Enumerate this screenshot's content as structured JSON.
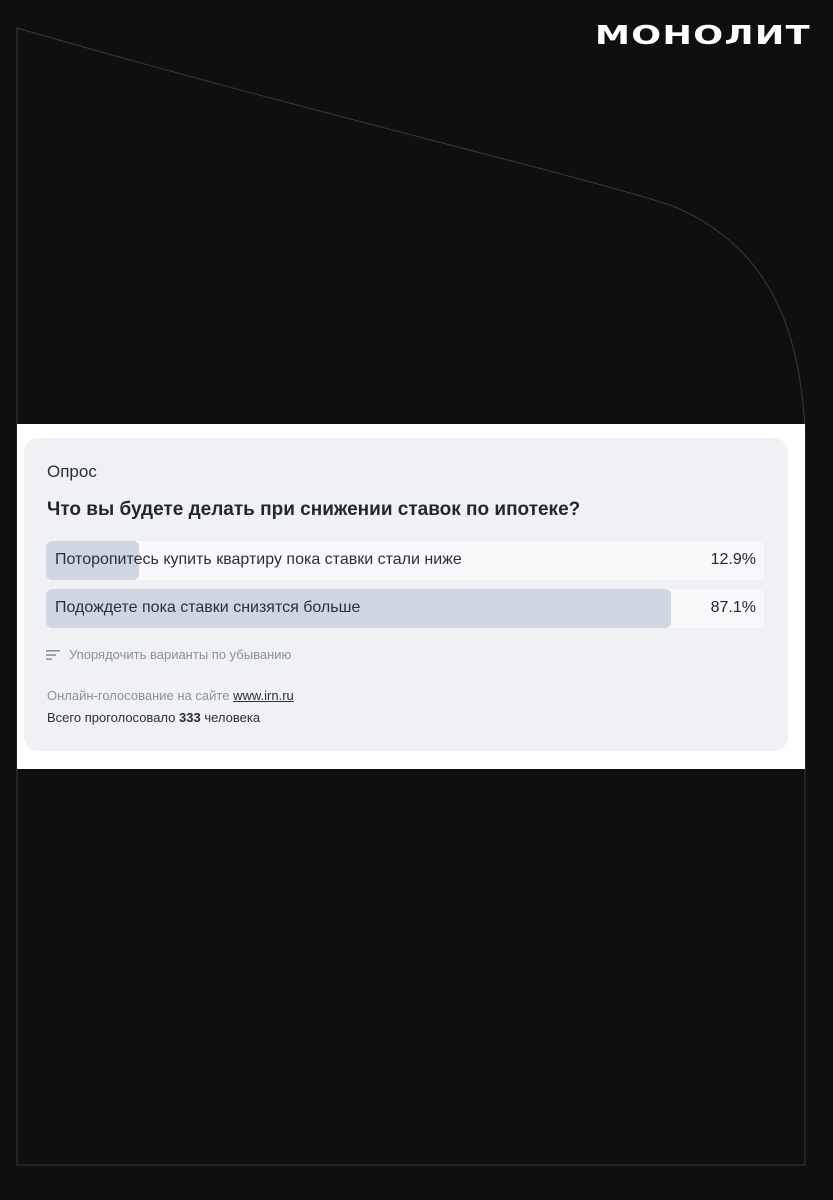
{
  "brand": {
    "logo_text": "МОНОЛИТ"
  },
  "poll": {
    "label": "Опрос",
    "question": "Что вы будете делать при снижении ставок по ипотеке?",
    "options": [
      {
        "text": "Поторопитесь купить квартиру пока ставки стали ниже",
        "percent_label": "12.9%",
        "percent": 12.9
      },
      {
        "text": "Подождете пока ставки снизятся больше",
        "percent_label": "87.1%",
        "percent": 87.1
      }
    ],
    "sort_label": "Упорядочить варианты по убыванию",
    "sort_icon": "sort-lines-icon",
    "footer": {
      "online_text": "Онлайн-голосование на сайте",
      "site_link": "www.irn.ru",
      "total_prefix": "Всего проголосовало",
      "total_count": "333",
      "total_suffix": "человека"
    }
  },
  "colors": {
    "background": "#0f0f0f",
    "card": "#eff1f5",
    "bar_fill": "#cdd6e1",
    "bar_track": "#f8f9fb"
  }
}
